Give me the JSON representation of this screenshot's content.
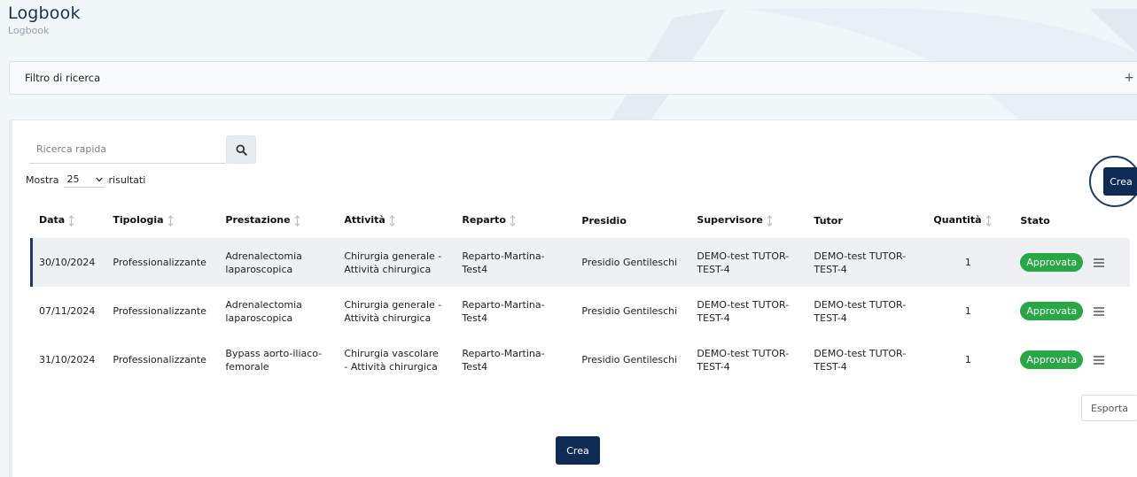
{
  "header": {
    "title": "Logbook",
    "breadcrumb": "Logbook"
  },
  "filter": {
    "label": "Filtro di ricerca",
    "toggle_icon": "plus-icon"
  },
  "search": {
    "placeholder": "Ricerca rapida",
    "icon": "search-icon"
  },
  "page_size": {
    "prefix": "Mostra",
    "value": "25",
    "suffix": "risultati"
  },
  "buttons": {
    "create_label": "Crea",
    "export_label": "Esporta"
  },
  "table": {
    "columns": [
      {
        "label": "Data",
        "sortable": true
      },
      {
        "label": "Tipologia",
        "sortable": true
      },
      {
        "label": "Prestazione",
        "sortable": true
      },
      {
        "label": "Attività",
        "sortable": true
      },
      {
        "label": "Reparto",
        "sortable": true
      },
      {
        "label": "Presidio",
        "sortable": false
      },
      {
        "label": "Supervisore",
        "sortable": true
      },
      {
        "label": "Tutor",
        "sortable": false
      },
      {
        "label": "Quantità",
        "sortable": true
      },
      {
        "label": "Stato",
        "sortable": false
      }
    ],
    "rows": [
      {
        "data": "30/10/2024",
        "tipologia": "Professionalizzante",
        "prestazione": "Adrenalectomia laparoscopica",
        "attivita": "Chirurgia generale - Attività chirurgica",
        "reparto": "Reparto-Martina-Test4",
        "presidio": "Presidio Gentileschi",
        "supervisore": "DEMO-test TUTOR-TEST-4",
        "tutor": "DEMO-test TUTOR-TEST-4",
        "quantita": "1",
        "stato": "Approvata"
      },
      {
        "data": "07/11/2024",
        "tipologia": "Professionalizzante",
        "prestazione": "Adrenalectomia laparoscopica",
        "attivita": "Chirurgia generale - Attività chirurgica",
        "reparto": "Reparto-Martina-Test4",
        "presidio": "Presidio Gentileschi",
        "supervisore": "DEMO-test TUTOR-TEST-4",
        "tutor": "DEMO-test TUTOR-TEST-4",
        "quantita": "1",
        "stato": "Approvata"
      },
      {
        "data": "31/10/2024",
        "tipologia": "Professionalizzante",
        "prestazione": "Bypass aorto-iliaco-femorale",
        "attivita": "Chirurgia vascolare - Attività chirurgica",
        "reparto": "Reparto-Martina-Test4",
        "presidio": "Presidio Gentileschi",
        "supervisore": "DEMO-test TUTOR-TEST-4",
        "tutor": "DEMO-test TUTOR-TEST-4",
        "quantita": "1",
        "stato": "Approvata"
      }
    ]
  },
  "colors": {
    "brand": "#0d2b55",
    "approved": "#28a745",
    "page_bg": "#f1f6f9"
  }
}
